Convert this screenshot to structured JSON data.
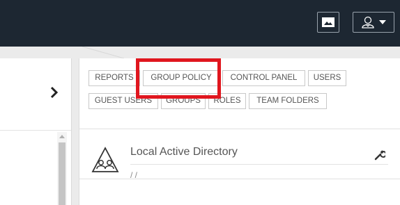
{
  "topbar": {
    "folder_icon": "folder-icon",
    "user_icon": "user-icon",
    "caret_icon": "caret-down-icon",
    "background": "#1d2732"
  },
  "left_panel": {
    "collapse_icon": "chevron-right-icon"
  },
  "tabs": [
    {
      "label": "REPORTS"
    },
    {
      "label": "GROUP POLICY"
    },
    {
      "label": "CONTROL PANEL"
    },
    {
      "label": "USERS"
    },
    {
      "label": "GUEST USERS"
    },
    {
      "label": "GROUPS"
    },
    {
      "label": "ROLES"
    },
    {
      "label": "TEAM FOLDERS"
    }
  ],
  "directory": {
    "title": "Local Active Directory",
    "subtitle": "/ /",
    "icon": "group-triangle-icon",
    "settings_icon": "wrench-icon"
  },
  "highlight_color": "#e0161e"
}
